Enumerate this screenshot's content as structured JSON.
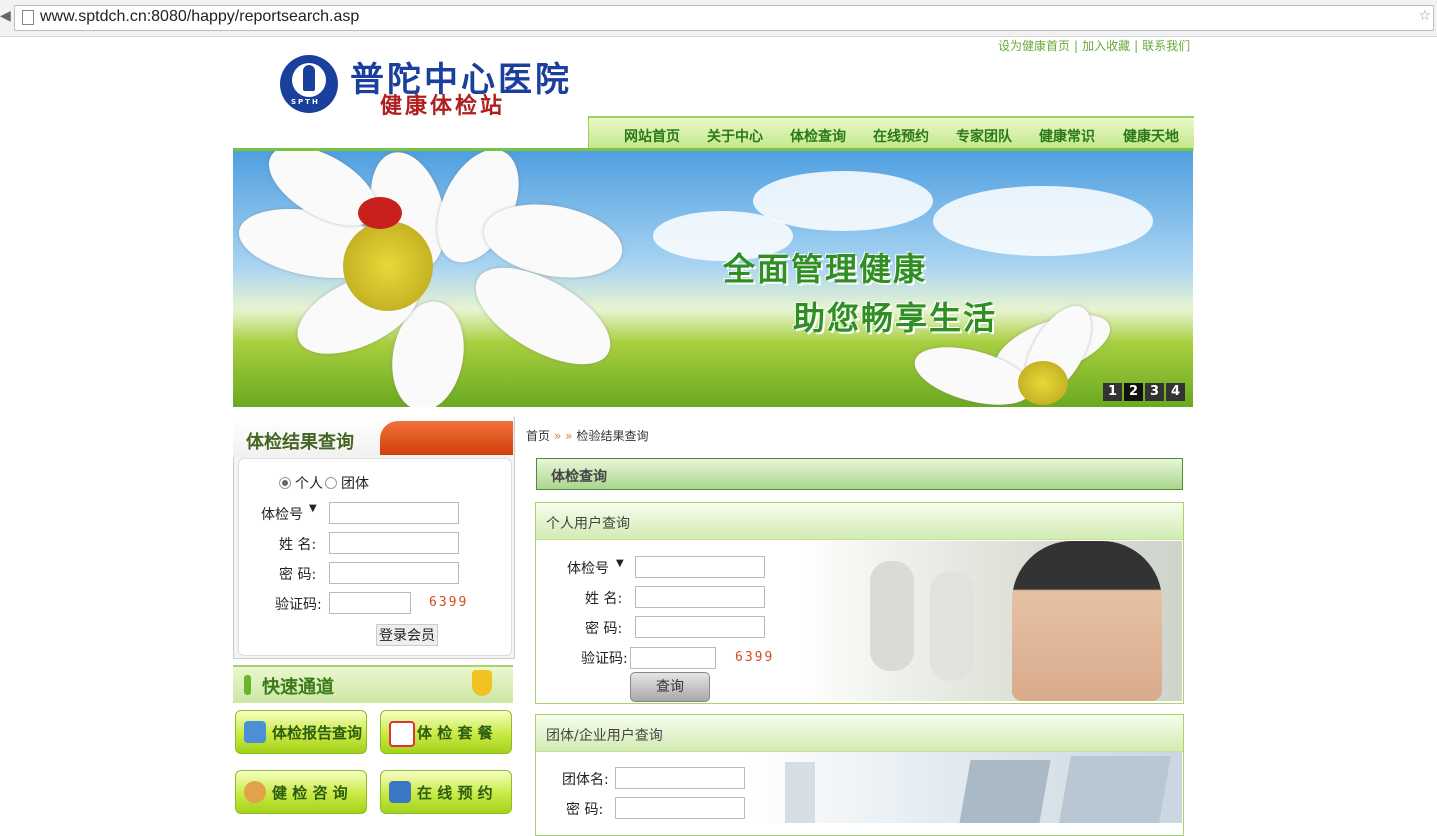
{
  "browser": {
    "url": "www.sptdch.cn:8080/happy/reportsearch.asp"
  },
  "top_links": [
    "设为健康首页",
    "加入收藏",
    "联系我们"
  ],
  "logo": {
    "title": "普陀中心医院",
    "subtitle": "健康体检站",
    "badge": "SPTH"
  },
  "nav": [
    "网站首页",
    "关于中心",
    "体检查询",
    "在线预约",
    "专家团队",
    "健康常识",
    "健康天地"
  ],
  "banner": {
    "line1": "全面管理健康",
    "line2": "助您畅享生活",
    "slides": [
      "1",
      "2",
      "3",
      "4"
    ],
    "active_slide": "2"
  },
  "left_panel": {
    "title": "体检结果查询",
    "radio_personal": "个人",
    "radio_group": "团体",
    "field_id": "体检号",
    "field_id_arrow": "▼",
    "field_name": "姓  名:",
    "field_password": "密  码:",
    "field_captcha": "验证码:",
    "captcha": "6399",
    "login_button": "登录会员"
  },
  "quick_access": {
    "title": "快速通道",
    "buttons": [
      "体检报告查询",
      "体 检 套 餐",
      "健 检 咨 询",
      "在 线 预 约"
    ]
  },
  "breadcrumb": {
    "home": "首页",
    "sep": "» »",
    "current": "检验结果查询"
  },
  "main": {
    "header": "体检查询",
    "personal": {
      "title": "个人用户查询",
      "field_id": "体检号",
      "field_id_arrow": "▼",
      "field_name": "姓  名:",
      "field_password": "密  码:",
      "field_captcha": "验证码:",
      "captcha": "6399",
      "query_button": "查询"
    },
    "group": {
      "title": "团体/企业用户查询",
      "field_group_name": "团体名:",
      "field_password": "密  码:"
    }
  },
  "colors": {
    "brand_green": "#2a7a1a",
    "accent_red": "#d03d0b",
    "logo_blue": "#1a3f9c"
  }
}
